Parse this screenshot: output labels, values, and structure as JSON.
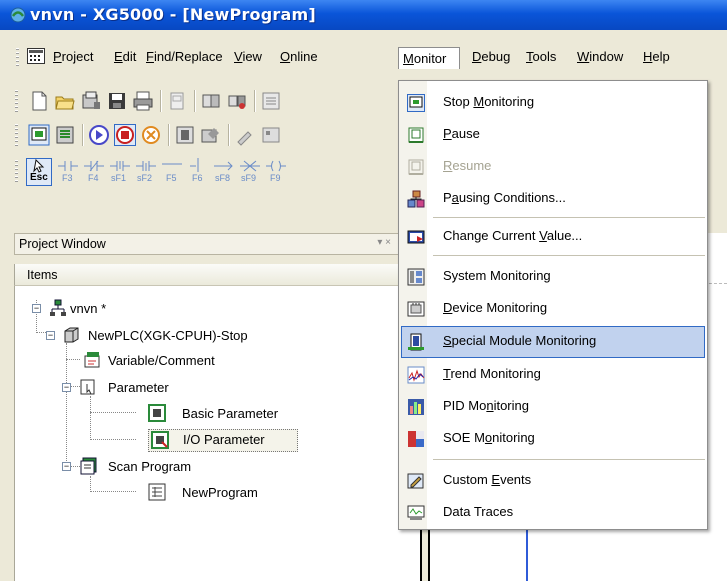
{
  "window": {
    "title": "vnvn - XG5000 - [NewProgram]"
  },
  "menubar": {
    "items": [
      {
        "label": "Project",
        "key": "P"
      },
      {
        "label": "Edit",
        "key": "E"
      },
      {
        "label": "Find/Replace",
        "key": "F"
      },
      {
        "label": "View",
        "key": "V"
      },
      {
        "label": "Online",
        "key": "O"
      },
      {
        "label": "Monitor",
        "key": "M",
        "active": true
      },
      {
        "label": "Debug",
        "key": "D"
      },
      {
        "label": "Tools",
        "key": "T"
      },
      {
        "label": "Window",
        "key": "W"
      },
      {
        "label": "Help",
        "key": "H"
      }
    ]
  },
  "toolbar3": {
    "keys": [
      "Esc",
      "F3",
      "F4",
      "sF1",
      "sF2",
      "F5",
      "F6",
      "sF8",
      "sF9",
      "F9"
    ]
  },
  "project_window": {
    "title": "Project Window",
    "items_header": "Items",
    "tree": {
      "project": "vnvn *",
      "plc": "NewPLC(XGK-CPUH)-Stop",
      "variable": "Variable/Comment",
      "parameter": "Parameter",
      "basic_param": "Basic Parameter",
      "io_param": "I/O Parameter",
      "scan_program": "Scan Program",
      "new_program": "NewProgram"
    }
  },
  "monitor_menu": {
    "items": [
      {
        "label": "Stop Monitoring",
        "icon": "stop-monitoring-icon"
      },
      {
        "label": "Pause",
        "icon": "pause-icon"
      },
      {
        "label": "Resume",
        "icon": "resume-icon",
        "disabled": true
      },
      {
        "label": "Pausing Conditions...",
        "icon": "pausing-conditions-icon"
      },
      {
        "label": "Change Current Value...",
        "icon": "change-value-icon"
      },
      {
        "label": "System Monitoring",
        "icon": "system-monitoring-icon"
      },
      {
        "label": "Device Monitoring",
        "icon": "device-monitoring-icon"
      },
      {
        "label": "Special Module Monitoring",
        "icon": "special-module-icon",
        "highlighted": true
      },
      {
        "label": "Trend Monitoring",
        "icon": "trend-icon"
      },
      {
        "label": "PID Monitoring",
        "icon": "pid-icon"
      },
      {
        "label": "SOE Monitoring",
        "icon": "soe-icon"
      },
      {
        "label": "Custom Events",
        "icon": "custom-events-icon"
      },
      {
        "label": "Data Traces",
        "icon": "data-traces-icon"
      }
    ]
  },
  "colors": {
    "titlebar": "#0a55d9",
    "menu_highlight": "#c1d2ee",
    "menu_highlight_border": "#316ac5",
    "chrome": "#ece9d8"
  }
}
